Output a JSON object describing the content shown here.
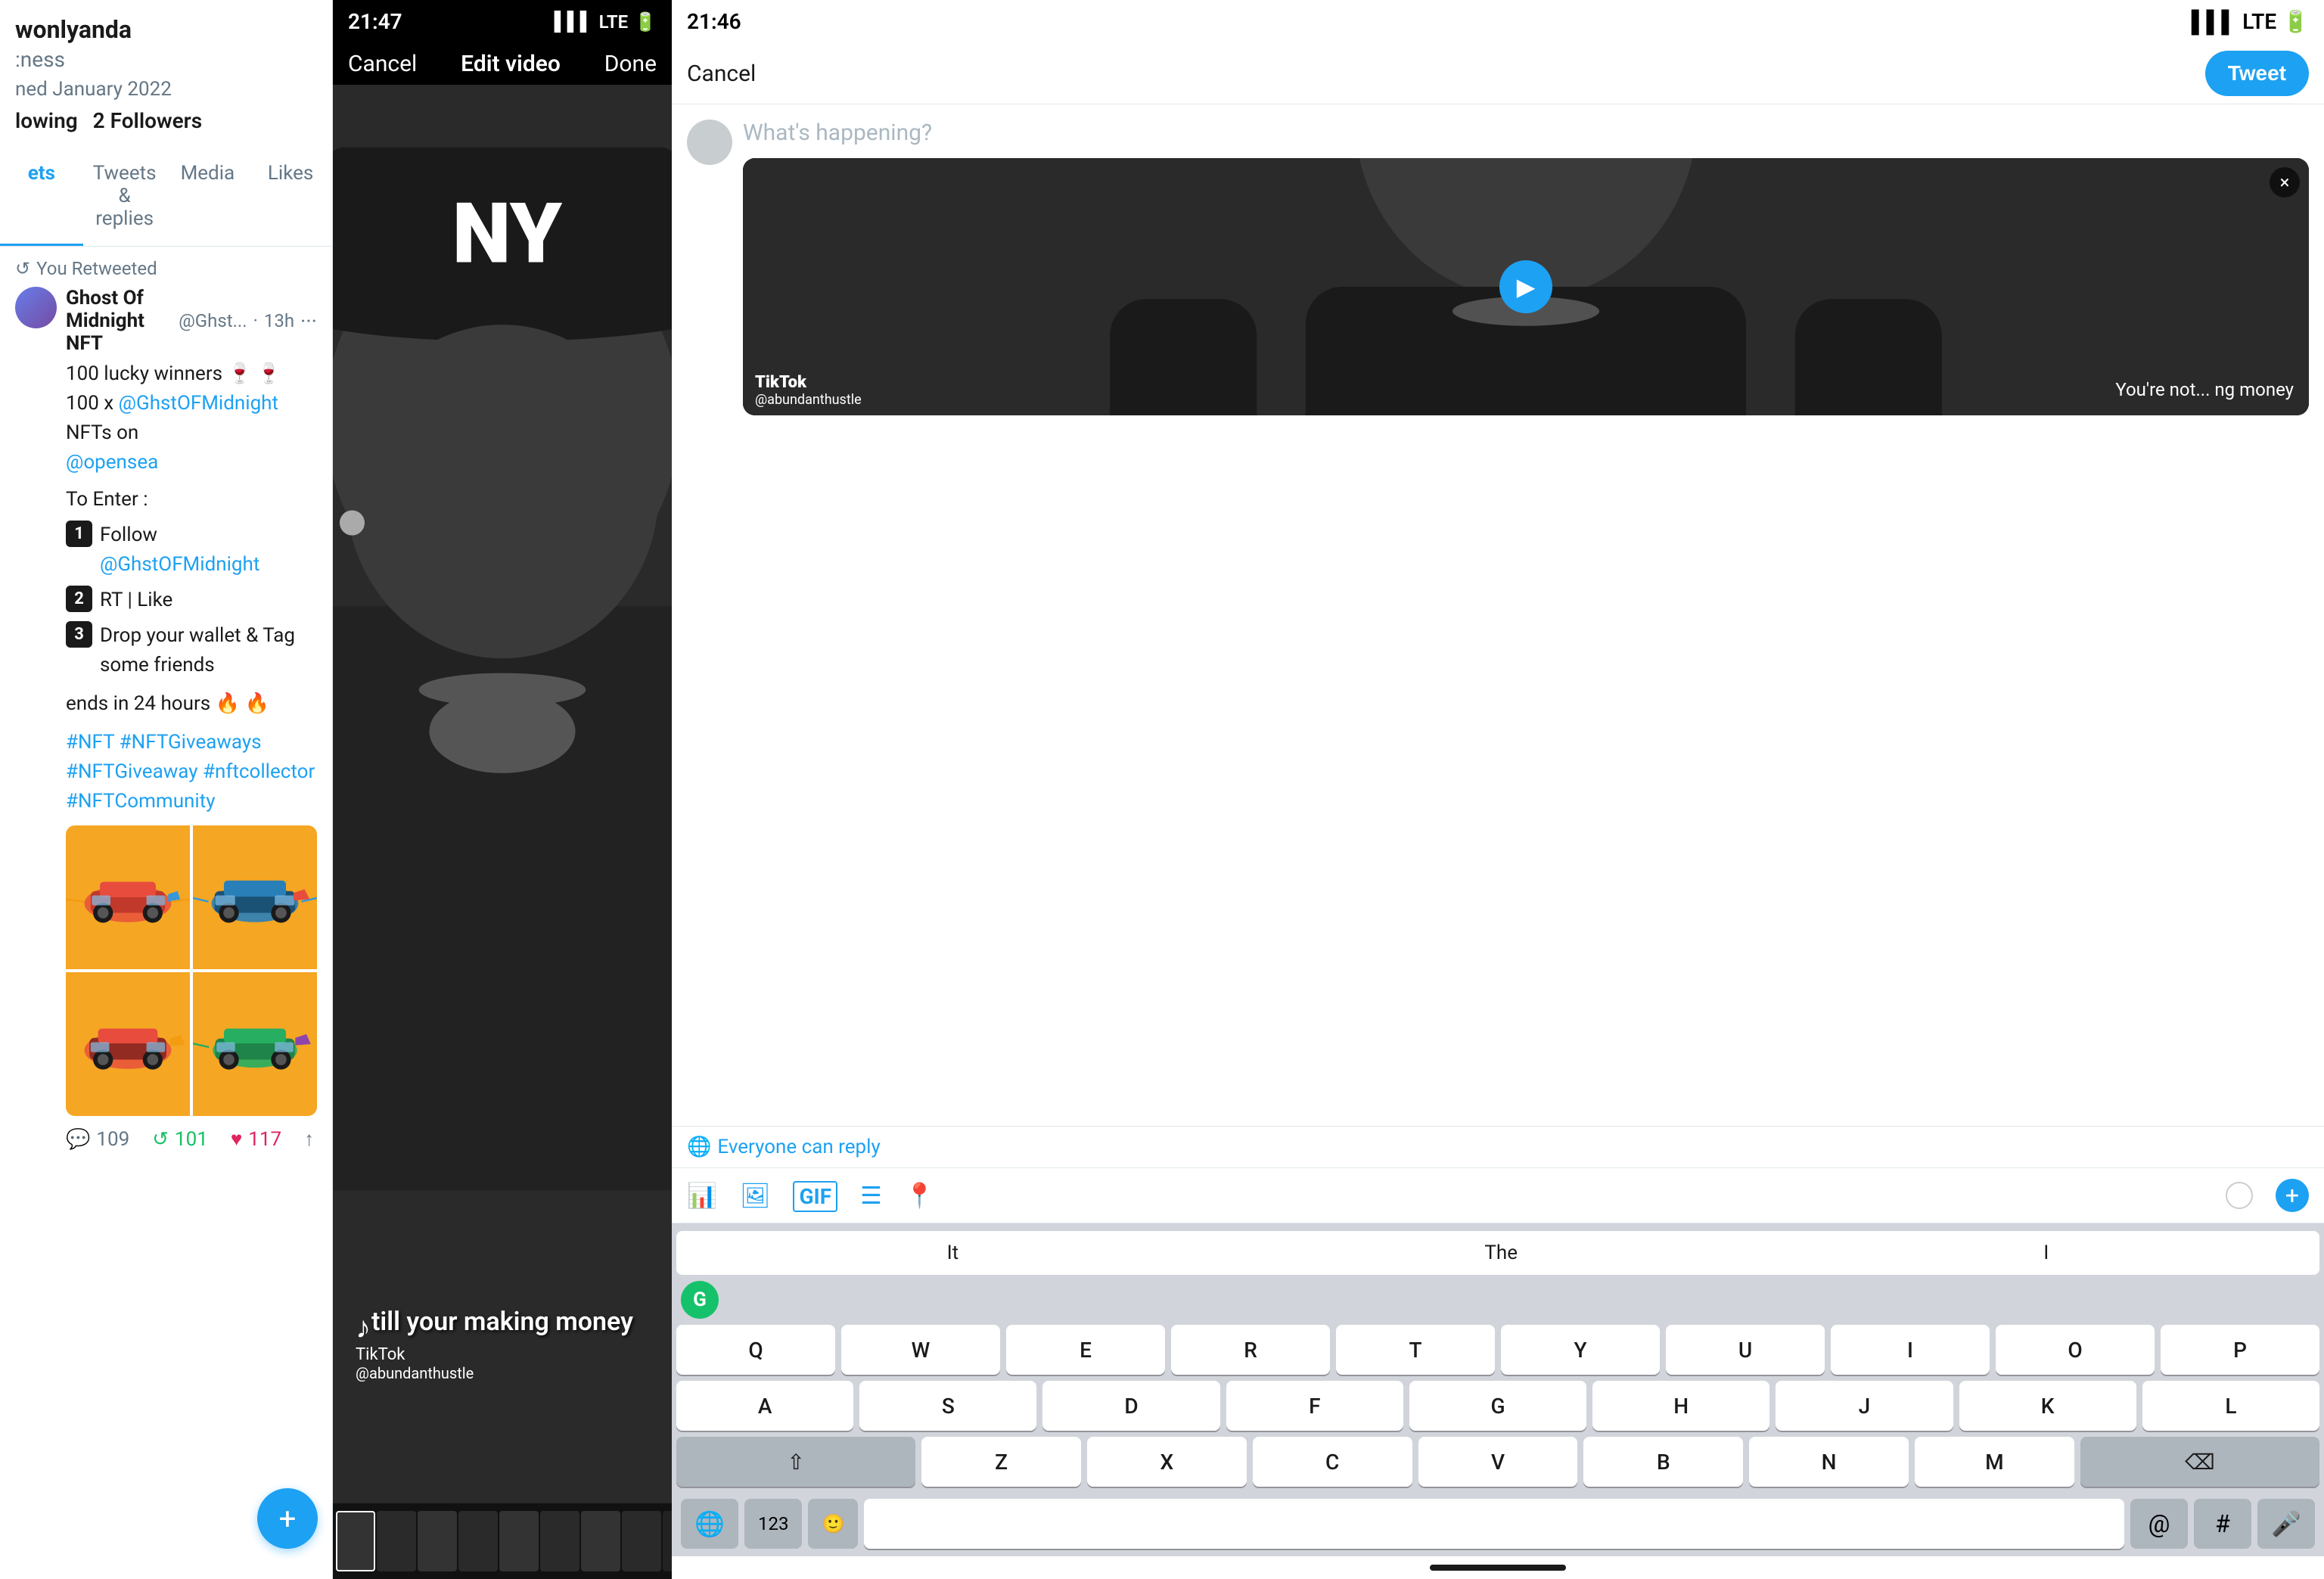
{
  "panel1": {
    "username": "wonlyanda",
    "handle": ":ness",
    "joined": "ned January 2022",
    "following": "lowing",
    "followers": "2 Followers",
    "tabs": {
      "tweets": "ets",
      "tweets_replies": "Tweets & replies",
      "media": "Media",
      "likes": "Likes"
    },
    "retweet_label": "You Retweeted",
    "tweet": {
      "author": "Ghost Of Midnight NFT",
      "author_handle": "@Ghst...",
      "time": "13h",
      "line1": "100 lucky winners 🍷 🍷",
      "line2_pre": "100 x ",
      "line2_mention": "@GhstOFMidnight",
      "line2_post": " NFTs on",
      "mention2": "@opensea",
      "to_enter": "To Enter :",
      "step1_pre": "Follow ",
      "step1_mention": "@GhstOFMidnight",
      "step2": "RT | Like",
      "step3": "Drop your wallet & Tag some friends",
      "ends": "ends in 24 hours 🔥 🔥",
      "hashtags": "#NFT #NFTGiveaways #NFTGiveaway #nftcollector #NFTCommunity",
      "comments": "109",
      "retweets": "101",
      "likes": "117"
    },
    "fab_icon": "+"
  },
  "panel2": {
    "status_time": "21:47",
    "signal": "▌▌▌",
    "network": "LTE",
    "cancel": "Cancel",
    "title": "Edit video",
    "done": "Done",
    "caption": "till your making money",
    "tiktok_handle": "@abundanthustle"
  },
  "panel3": {
    "status_time": "21:46",
    "cancel": "Cancel",
    "tweet_button": "Tweet",
    "placeholder": "What's happening?",
    "reply_label": "Everyone can reply",
    "close_icon": "×",
    "caption_overlay": "You're not... ng money",
    "tiktok_handle": "@abundanthustle",
    "keyboard": {
      "suggestions": [
        "It",
        "The",
        "I"
      ],
      "row1": [
        "Q",
        "W",
        "E",
        "R",
        "T",
        "Y",
        "U",
        "I",
        "O",
        "P"
      ],
      "row2": [
        "A",
        "S",
        "D",
        "F",
        "G",
        "H",
        "J",
        "K",
        "L"
      ],
      "row3": [
        "Z",
        "X",
        "C",
        "V",
        "B",
        "N",
        "M"
      ],
      "symbol_key": "123",
      "emoji_key": "🙂",
      "at_key": "@",
      "hash_key": "#",
      "delete_key": "⌫",
      "shift_key": "⇧",
      "globe_key": "🌐",
      "mic_key": "🎤"
    }
  }
}
